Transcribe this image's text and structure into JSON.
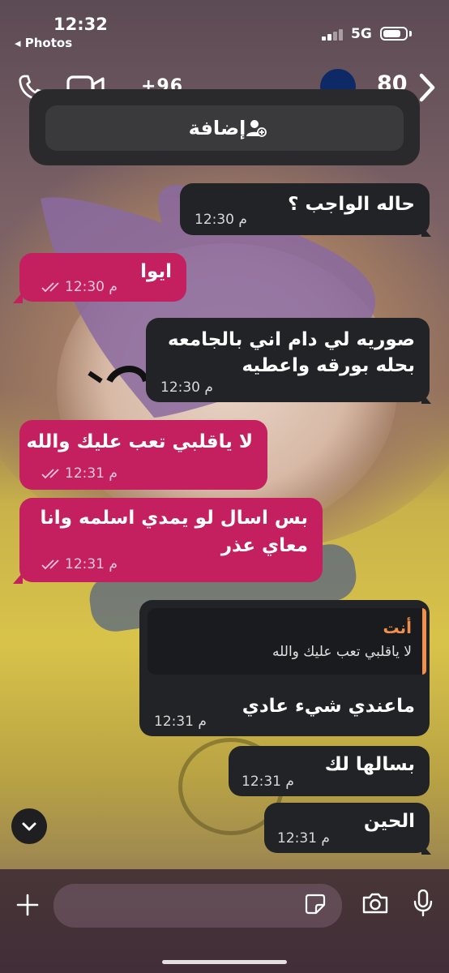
{
  "status_bar": {
    "time": "12:32",
    "back_app": "◂ Photos",
    "network": "5G",
    "battery_level": 0.8
  },
  "header": {
    "contact_number": "+96",
    "unread_count": "80"
  },
  "add_card": {
    "button_label": "إضافة"
  },
  "messages": [
    {
      "dir": "in",
      "text": "حاله الواجب ؟",
      "time": "12:30 م"
    },
    {
      "dir": "out",
      "text": "ايوا",
      "time": "12:30 م",
      "status": "read"
    },
    {
      "dir": "in",
      "lines": [
        "صوريه لي دام اني بالجامعه",
        "بحله بورقه واعطيه"
      ],
      "time": "12:30 م"
    },
    {
      "dir": "out",
      "text": "لا ياقلبي تعب عليك والله",
      "time": "12:31 م",
      "status": "read"
    },
    {
      "dir": "out",
      "lines": [
        "بس اسال لو يمدي اسلمه وانا",
        "معاي عذر"
      ],
      "time": "12:31 م",
      "status": "read"
    },
    {
      "dir": "in",
      "reply_to": {
        "sender": "أنت",
        "text": "لا ياقلبي تعب عليك والله"
      },
      "text": "ماعندي شيء عادي",
      "time": "12:31 م"
    },
    {
      "dir": "in",
      "text": "بسالها لك",
      "time": "12:31 م"
    },
    {
      "dir": "in",
      "text": "الحين",
      "time": "12:31 م"
    }
  ],
  "composer": {
    "placeholder": ""
  },
  "colors": {
    "outgoing_bubble": "#c4205f",
    "incoming_bubble": "#222326",
    "reply_accent": "#f0904a",
    "avatar": "#0d2a66"
  },
  "icons": [
    "phone-icon",
    "video-camera-icon",
    "chevron-right-icon",
    "add-contact-icon",
    "double-check-icon",
    "chevron-down-icon",
    "plus-icon",
    "sticker-icon",
    "camera-icon",
    "microphone-icon"
  ]
}
